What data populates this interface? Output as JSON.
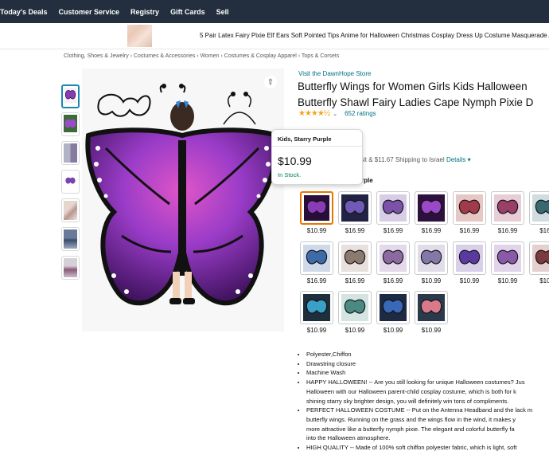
{
  "nav": {
    "items": [
      "Today's Deals",
      "Customer Service",
      "Registry",
      "Gift Cards",
      "Sell"
    ]
  },
  "ad": {
    "text": "5 Pair Latex Fairy Pixie Elf Ears Soft Pointed Tips Anime for Halloween Christmas Cosplay Dress Up Costume Masquerade Acc"
  },
  "breadcrumb": "Clothing, Shoes & Jewelry › Costumes & Accessories › Women › Costumes & Cosplay Apparel › Tops & Corsets",
  "product": {
    "store_link": "Visit the DawnHope Store",
    "title_line1": "Butterfly Wings for Women Girls Kids Halloween",
    "title_line2": "Butterfly Shawl Fairy Ladies Cape Nymph Pixie D",
    "stars": "★★★★½",
    "ratings": "652 ratings",
    "shipping_partial": "sit & $11.67 Shipping to Israel",
    "shipping_details": "Details ▾",
    "color_label_partial": "rple"
  },
  "popover": {
    "header": "Kids, Starry Purple",
    "price": "$10.99",
    "stock": "In Stock."
  },
  "swatches": [
    {
      "price": "$10.99",
      "color": "#8a3cb8",
      "color2": "#2a0e3a"
    },
    {
      "price": "$16.99",
      "color": "#6f5ab8",
      "color2": "#222244"
    },
    {
      "price": "$16.99",
      "color": "#7a52a8",
      "color2": "#d7cde6"
    },
    {
      "price": "$16.99",
      "color": "#9b48c8",
      "color2": "#2e103e"
    },
    {
      "price": "$16.99",
      "color": "#a13a4a",
      "color2": "#e6c7c4"
    },
    {
      "price": "$16.99",
      "color": "#9a4068",
      "color2": "#e6cdd6"
    },
    {
      "price": "$16.",
      "color": "#3a6870",
      "color2": "#cfdde0"
    },
    {
      "price": "$16.99",
      "color": "#3f6aa8",
      "color2": "#cfd9e8"
    },
    {
      "price": "$16.99",
      "color": "#8a7a70",
      "color2": "#e8e0dc"
    },
    {
      "price": "$16.99",
      "color": "#8a6aa0",
      "color2": "#e4d9ea"
    },
    {
      "price": "$10.99",
      "color": "#8478a8",
      "color2": "#e0dde8"
    },
    {
      "price": "$10.99",
      "color": "#5a3aa0",
      "color2": "#d8cfe8"
    },
    {
      "price": "$10.99",
      "color": "#8a5aa8",
      "color2": "#e1d4ea"
    },
    {
      "price": "$10.",
      "color": "#7a3a40",
      "color2": "#e6d0cf"
    },
    {
      "price": "$10.99",
      "color": "#3aa0c8",
      "color2": "#1e2e3a"
    },
    {
      "price": "$10.99",
      "color": "#4a8a82",
      "color2": "#d3e4e1"
    },
    {
      "price": "$10.99",
      "color": "#3a68b8",
      "color2": "#1e2a44"
    },
    {
      "price": "$10.99",
      "color": "#d87a8a",
      "color2": "#2a3a4a"
    }
  ],
  "bullets": [
    "Polyester,Chiffon",
    "Drawstring closure",
    "Machine Wash",
    "HAPPY HALLOWEEN! -- Are you still looking for unique Halloween costumes? Jus",
    "Halloween with our Halloween parent-child cosplay costume, which is both for k",
    "shining starry sky brighter design, you will definitely win tons of compliments.",
    "PERFECT HALLOWEEN COSTUME -- Put on the Antenna Headband and the lack m",
    "butterfly wings. Running on the grass and the wings flow in the wind, it makes y",
    "more attractive like a butterfly nymph pixie. The elegant and colorful butterfly fa",
    "into the Halloween atmosphere.",
    "HIGH QUALITY -- Made of 100% soft chiffon polyester fabric, which is light, soft"
  ],
  "colors": {
    "nav_bg": "#232f3e",
    "link": "#007185",
    "selected_swatch": "#e77600",
    "in_stock": "#067d62",
    "star": "#f4a41c"
  }
}
